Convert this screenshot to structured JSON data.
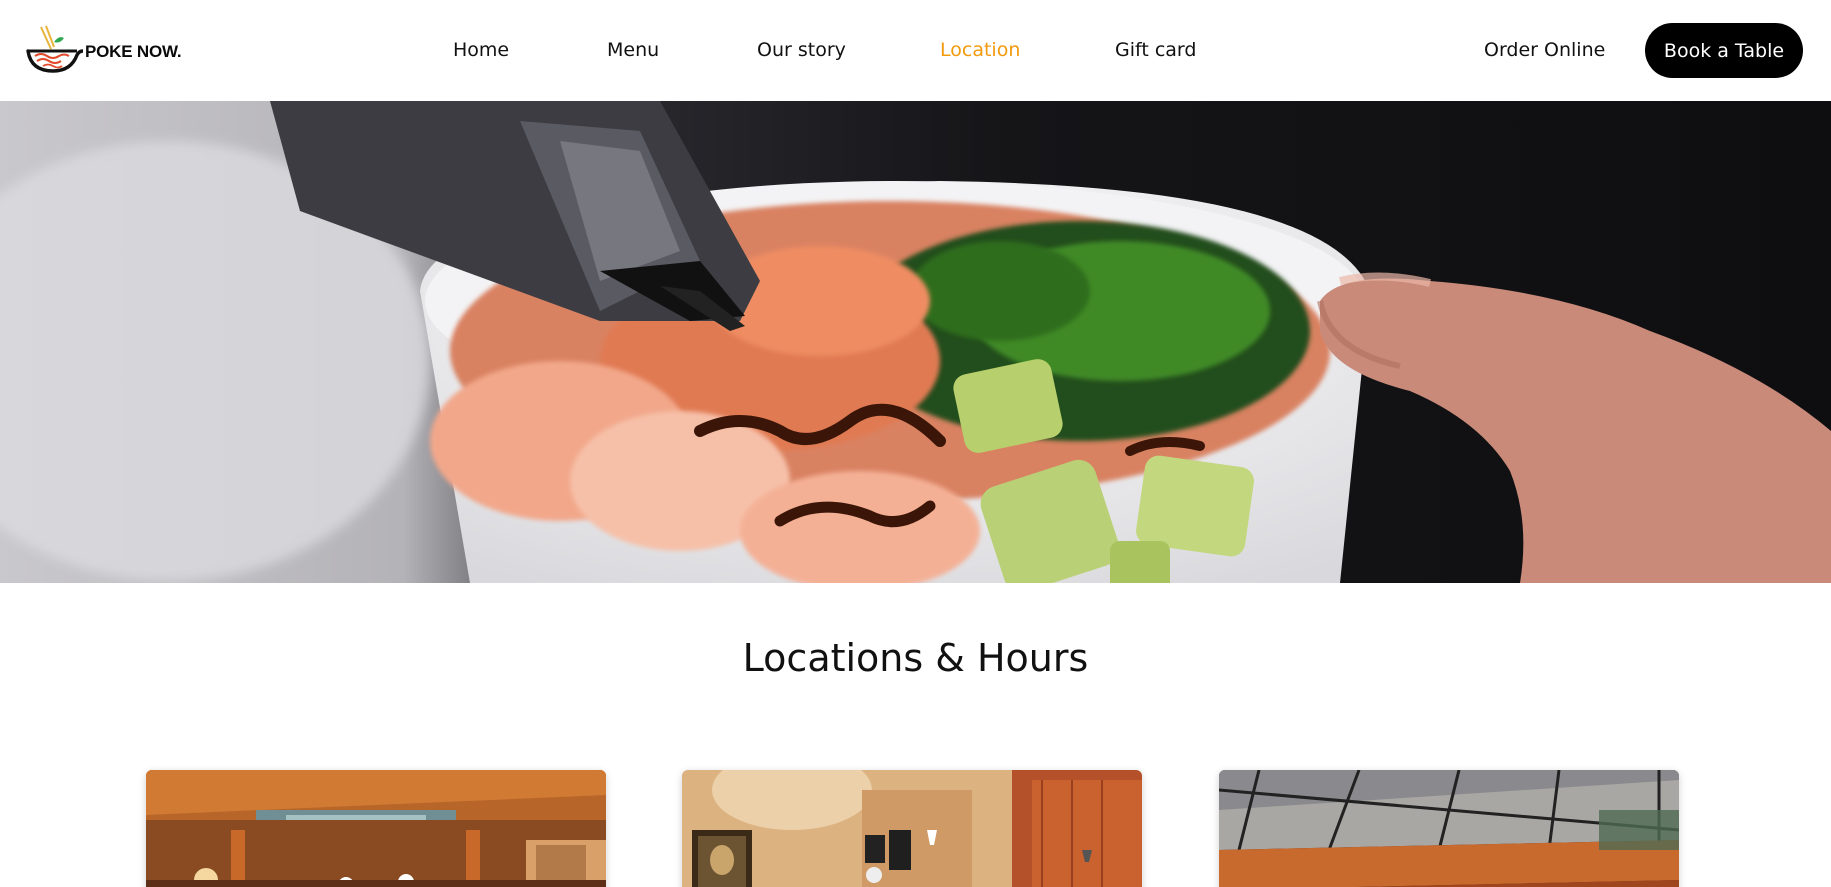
{
  "brand": {
    "name": "POKE NOW.",
    "logo_icon": "poke-bowl-chopsticks-icon",
    "colors": {
      "accent": "#f29a0e",
      "bowl": "#111111",
      "noodle": "#e24b2b",
      "leaf": "#2fa84f"
    }
  },
  "nav": {
    "items": [
      {
        "label": "Home",
        "active": false
      },
      {
        "label": "Menu",
        "active": false
      },
      {
        "label": "Our story",
        "active": false
      },
      {
        "label": "Location",
        "active": true
      },
      {
        "label": "Gift card",
        "active": false
      }
    ],
    "active_color": "#f29a0e"
  },
  "actions": {
    "order_label": "Order Online",
    "book_label": "Book a Table",
    "book_bg": "#000000"
  },
  "hero": {
    "image": "poke-bowl-with-shrimp-salmon-avocado-seaweed-and-sauce-photo"
  },
  "locations": {
    "title": "Locations & Hours",
    "cards": [
      {
        "image": "restaurant-interior-wood-ceiling-photo"
      },
      {
        "image": "restaurant-interior-mona-lisa-wall-photo"
      },
      {
        "image": "restaurant-interior-steel-roof-photo"
      }
    ]
  }
}
